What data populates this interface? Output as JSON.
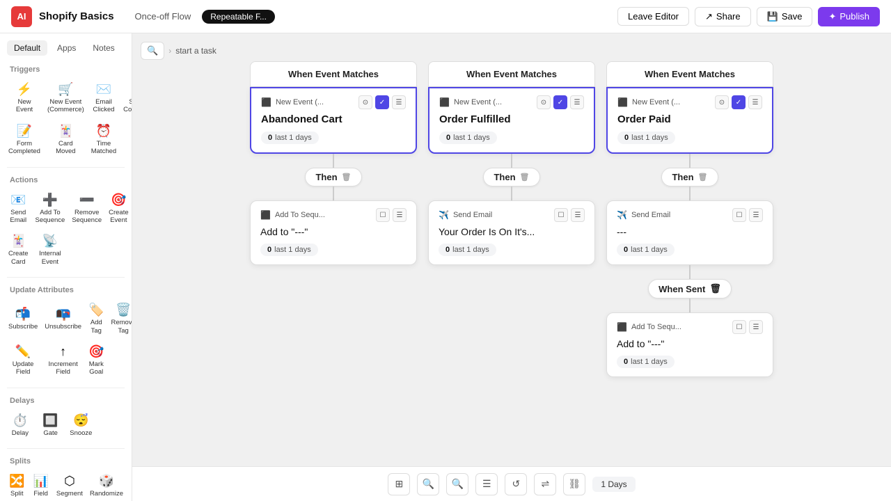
{
  "app": {
    "logo": "AI",
    "name": "Shopify Basics",
    "tab_once": "Once-off Flow",
    "tab_repeatable": "Repeatable F...",
    "btn_leave": "Leave Editor",
    "btn_share": "Share",
    "btn_save": "Save",
    "btn_publish": "Publish"
  },
  "sidebar": {
    "tabs": [
      "Default",
      "Apps",
      "Notes"
    ],
    "active_tab": "Default",
    "sections": {
      "triggers": {
        "label": "Triggers",
        "items": [
          {
            "id": "new-event",
            "icon": "⚡",
            "label": "New\nEvent"
          },
          {
            "id": "new-event-commerce",
            "icon": "🛒",
            "label": "New Event\n(Commerce)"
          },
          {
            "id": "email-clicked",
            "icon": "✉️",
            "label": "Email\nClicked"
          },
          {
            "id": "survey-completed",
            "icon": "📋",
            "label": "Survey\nCompleted"
          },
          {
            "id": "form-completed",
            "icon": "📝",
            "label": "Form\nCompleted"
          },
          {
            "id": "card-moved",
            "icon": "🃏",
            "label": "Card\nMoved"
          },
          {
            "id": "time-matched",
            "icon": "⏰",
            "label": "Time\nMatched"
          }
        ]
      },
      "actions": {
        "label": "Actions",
        "items": [
          {
            "id": "send-email",
            "icon": "📧",
            "label": "Send\nEmail"
          },
          {
            "id": "add-to-sequence",
            "icon": "➕",
            "label": "Add To\nSequence"
          },
          {
            "id": "remove-sequence",
            "icon": "➖",
            "label": "Remove\nSequence"
          },
          {
            "id": "create-event",
            "icon": "🎯",
            "label": "Create\nEvent"
          },
          {
            "id": "create-card",
            "icon": "🃏",
            "label": "Create\nCard"
          },
          {
            "id": "internal-event",
            "icon": "📡",
            "label": "Internal\nEvent"
          }
        ]
      },
      "update_attrs": {
        "label": "Update Attributes",
        "items": [
          {
            "id": "subscribe",
            "icon": "📬",
            "label": "Subscribe"
          },
          {
            "id": "unsubscribe",
            "icon": "📭",
            "label": "Unsubscribe"
          },
          {
            "id": "add-tag",
            "icon": "🏷️",
            "label": "Add Tag"
          },
          {
            "id": "remove-tag",
            "icon": "🗑️",
            "label": "Remove\nTag"
          },
          {
            "id": "update-field",
            "icon": "✏️",
            "label": "Update\nField"
          },
          {
            "id": "increment-field",
            "icon": "➕",
            "label": "Increment\nField"
          },
          {
            "id": "mark-goal",
            "icon": "🎯",
            "label": "Mark\nGoal"
          }
        ]
      },
      "delays": {
        "label": "Delays",
        "items": [
          {
            "id": "delay",
            "icon": "⏱️",
            "label": "Delay"
          },
          {
            "id": "gate",
            "icon": "🔲",
            "label": "Gate"
          },
          {
            "id": "snooze",
            "icon": "😴",
            "label": "Snooze"
          }
        ]
      },
      "splits": {
        "label": "Splits",
        "items": [
          {
            "id": "split",
            "icon": "🔀",
            "label": "Split"
          },
          {
            "id": "field",
            "icon": "📊",
            "label": "Field"
          },
          {
            "id": "segment",
            "icon": "⬡",
            "label": "Segment"
          },
          {
            "id": "randomize",
            "icon": "🎲",
            "label": "Randomize"
          }
        ]
      }
    }
  },
  "breadcrumb": {
    "search_icon": "🔍",
    "path": "start a task"
  },
  "flows": [
    {
      "id": "flow-1",
      "trigger_header": "When Event Matches",
      "event_label": "New Event (...",
      "event_main": "Abandoned Cart",
      "stat_num": "0",
      "stat_label": "last 1 days",
      "then_label": "Then",
      "action_type": "Add To Sequ...",
      "action_icon": "sequence",
      "action_main": "Add to \"---\"",
      "action_stat_num": "0",
      "action_stat_label": "last 1 days"
    },
    {
      "id": "flow-2",
      "trigger_header": "When Event Matches",
      "event_label": "New Event (...",
      "event_main": "Order Fulfilled",
      "stat_num": "0",
      "stat_label": "last 1 days",
      "then_label": "Then",
      "action_type": "Send Email",
      "action_icon": "email",
      "action_main": "Your Order Is On It's...",
      "action_stat_num": "0",
      "action_stat_label": "last 1 days"
    },
    {
      "id": "flow-3",
      "trigger_header": "When Event Matches",
      "event_label": "New Event (...",
      "event_main": "Order Paid",
      "stat_num": "0",
      "stat_label": "last 1 days",
      "then_label": "Then",
      "action_type": "Send Email",
      "action_icon": "email",
      "action_main": "---",
      "action_stat_num": "0",
      "action_stat_label": "last 1 days",
      "has_extra": true,
      "when_sent_label": "When Sent",
      "extra_action_type": "Add To Sequ...",
      "extra_action_main": "Add to \"---\"",
      "extra_stat_num": "0",
      "extra_stat_label": "last 1 days"
    }
  ],
  "toolbar": {
    "days": "1 Days"
  }
}
